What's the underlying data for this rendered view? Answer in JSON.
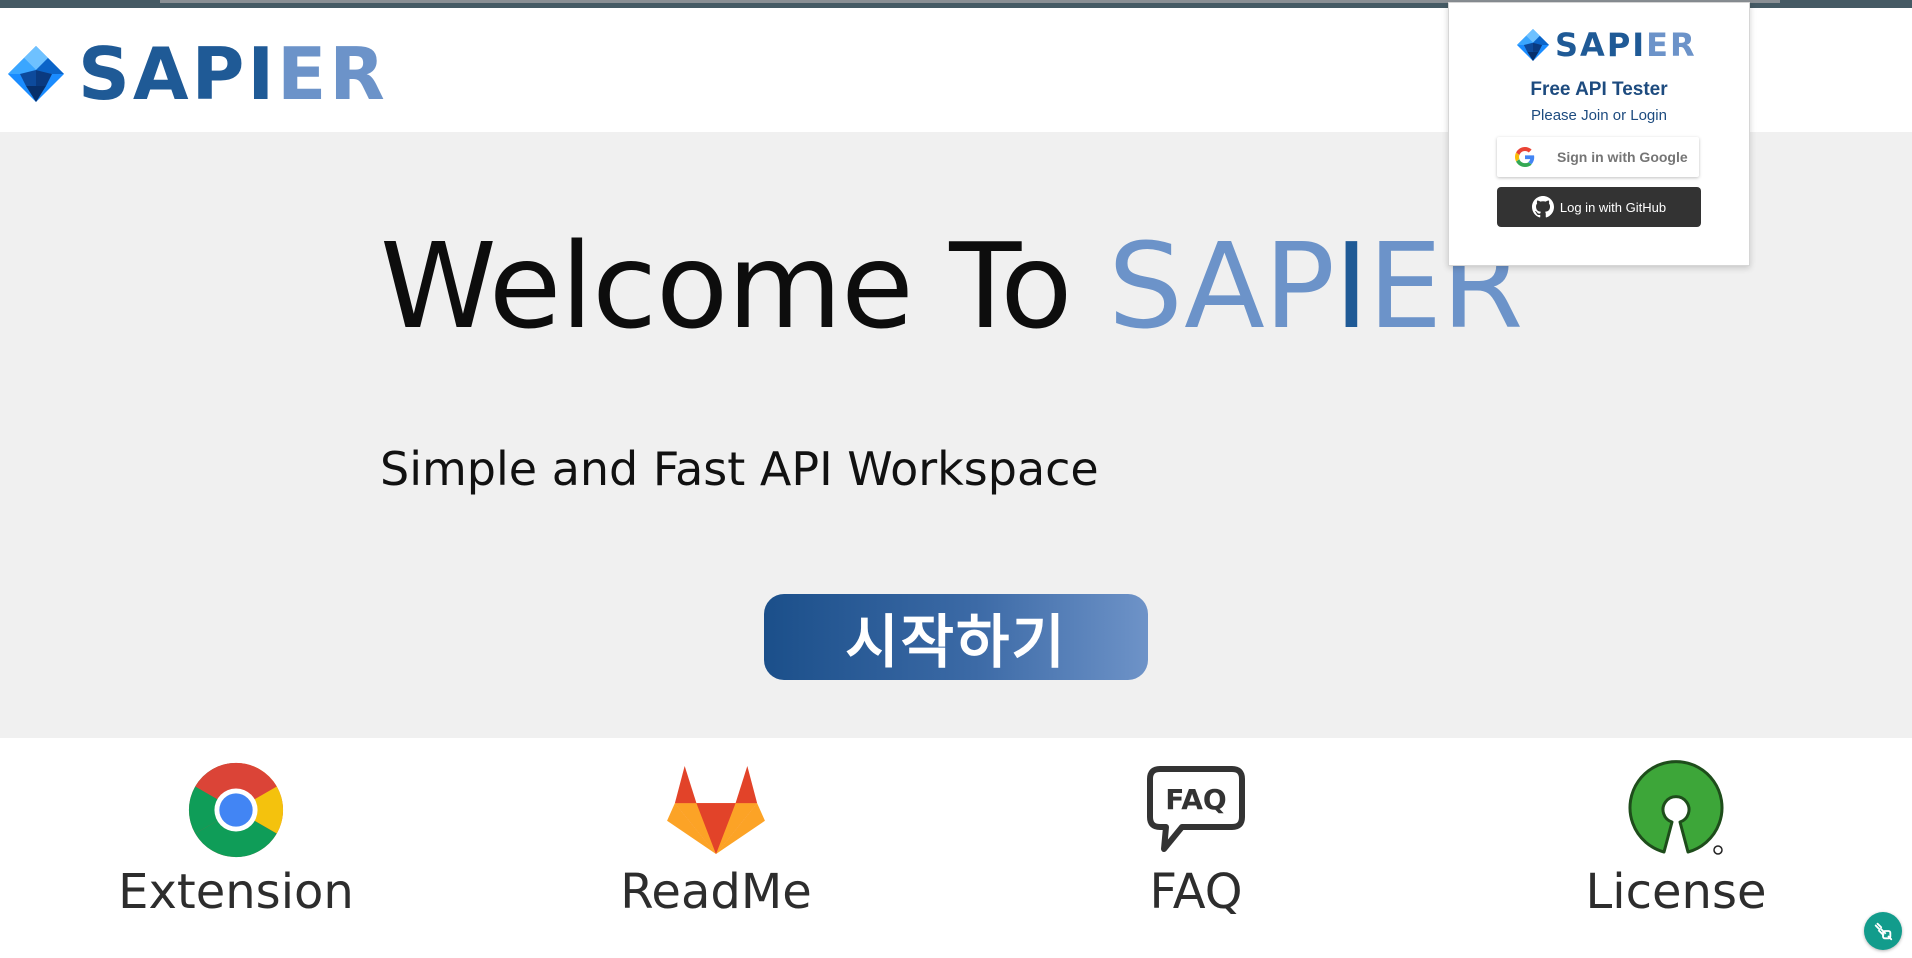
{
  "header": {
    "brand": {
      "part_dark": "SAPI",
      "part_light": "ER"
    }
  },
  "hero": {
    "title_prefix": "Welcome To ",
    "title_brand_light1": "SAP",
    "title_brand_dark": "I",
    "title_brand_light2": "ER",
    "subtitle": "Simple and Fast API Workspace",
    "start_label": "시작하기"
  },
  "features": [
    {
      "label": "Extension",
      "icon": "chrome-icon"
    },
    {
      "label": "ReadMe",
      "icon": "gitlab-icon"
    },
    {
      "label": "FAQ",
      "icon": "faq-icon"
    },
    {
      "label": "License",
      "icon": "open-source-icon"
    }
  ],
  "login": {
    "brand_dark": "SAPI",
    "brand_light": "ER",
    "title": "Free API Tester",
    "subtitle": "Please Join or Login",
    "google_label": "Sign in with Google",
    "github_label": "Log in with GitHub"
  },
  "faq_icon_text": "FAQ",
  "colors": {
    "brand_dark": "#1f5a96",
    "brand_light": "#6c93c9",
    "hero_bg": "#f0f0f0",
    "github_btn": "#333333",
    "fab": "#129c8c"
  }
}
